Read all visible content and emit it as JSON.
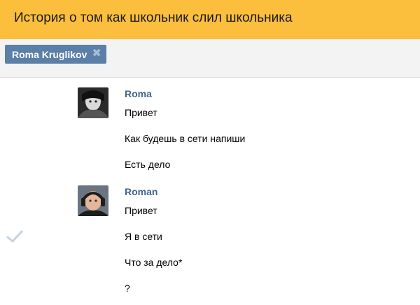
{
  "title": "История о том как школьник слил школьника",
  "peer_chip": {
    "label": "Roma Kruglikov",
    "close_icon": "close-icon"
  },
  "groups": [
    {
      "sender": "Roma",
      "avatar_icon": "avatar",
      "messages": [
        "Привет",
        "Как будешь в сети напиши",
        "Есть дело"
      ]
    },
    {
      "sender": "Roman",
      "avatar_icon": "avatar",
      "messages": [
        "Привет",
        "Я в сети",
        "Что за дело*",
        "?"
      ]
    }
  ],
  "colors": {
    "title_bar": "#fbbe3d",
    "chip": "#5b7fa6",
    "sender": "#42648b"
  }
}
